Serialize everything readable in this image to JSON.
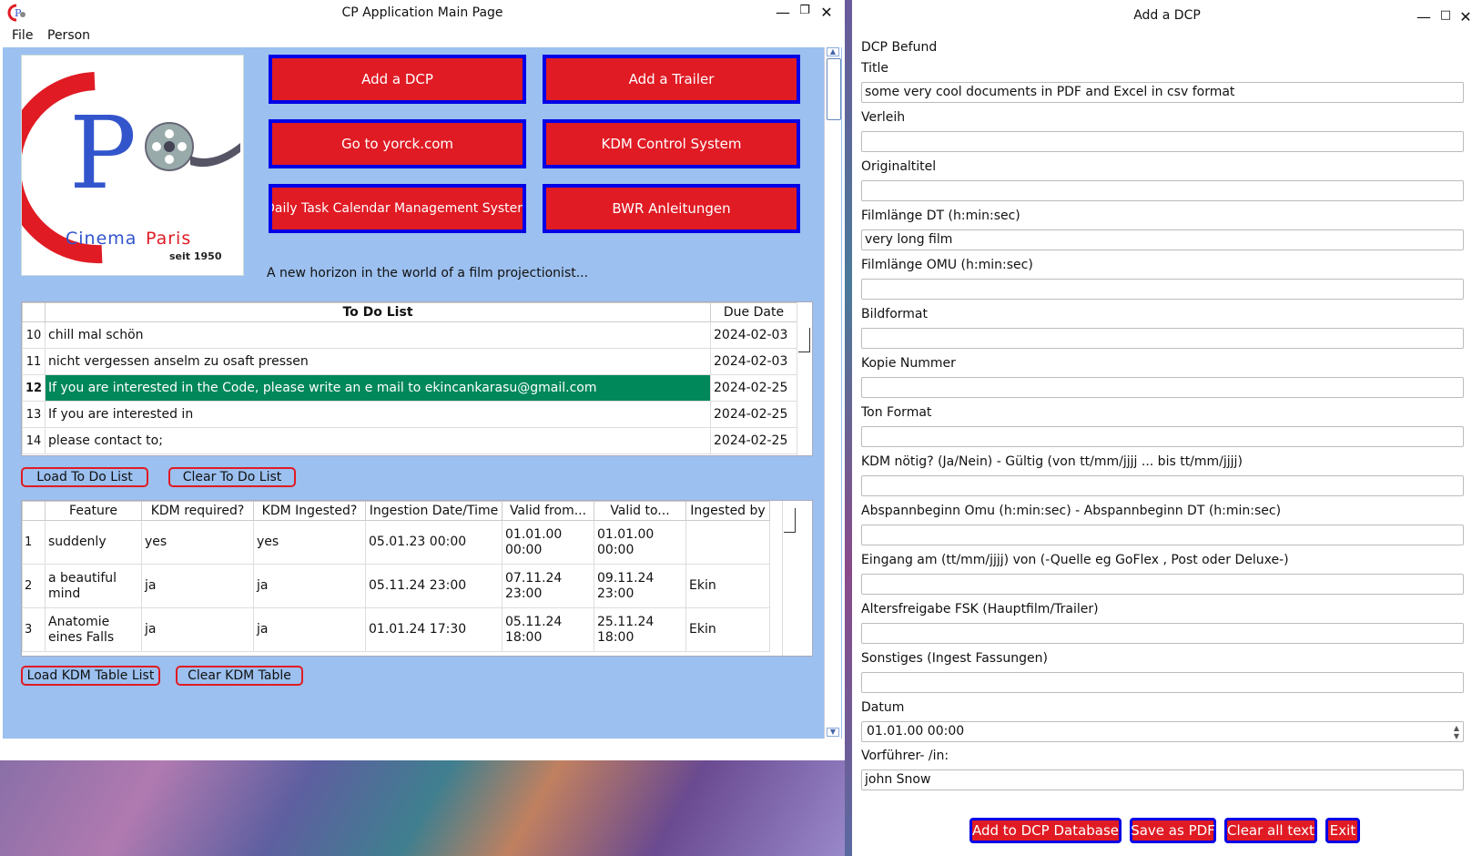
{
  "main_window": {
    "title": "CP Application Main Page",
    "menu": [
      "File",
      "Person"
    ],
    "logo": {
      "letter": "P",
      "name_1": "Cinema",
      "name_2": "Paris",
      "since": "seit 1950"
    },
    "buttons": [
      "Add a DCP",
      "Add a Trailer",
      "Go to yorck.com",
      "KDM Control System",
      "Daily Task Calendar Management System",
      "BWR Anleitungen"
    ],
    "tagline": "A new horizon in the world of a film projectionist...",
    "todo": {
      "headers": [
        "To Do List",
        "Due Date"
      ],
      "rows": [
        {
          "n": "10",
          "task": "chill mal schön",
          "due": "2024-02-03"
        },
        {
          "n": "11",
          "task": "nicht vergessen anselm zu osaft pressen",
          "due": "2024-02-03"
        },
        {
          "n": "12",
          "task": "If you are interested in the Code, please write an e mail to ekincankarasu@gmail.com",
          "due": "2024-02-25"
        },
        {
          "n": "13",
          "task": "If you are interested in",
          "due": "2024-02-25"
        },
        {
          "n": "14",
          "task": "please contact to;",
          "due": "2024-02-25"
        }
      ],
      "selected_row": "12",
      "load_label": "Load To Do List",
      "clear_label": "Clear To Do List"
    },
    "kdm": {
      "headers": [
        "Feature",
        "KDM required?",
        "KDM Ingested?",
        "Ingestion Date/Time",
        "Valid from...",
        "Valid to...",
        "Ingested by"
      ],
      "rows": [
        {
          "n": "1",
          "feature": "suddenly",
          "required": "yes",
          "ingested": "yes",
          "date": "05.01.23 00:00",
          "from": "01.01.00 00:00",
          "to": "01.01.00 00:00",
          "by": ""
        },
        {
          "n": "2",
          "feature": "a beautiful mind",
          "required": "ja",
          "ingested": "ja",
          "date": "05.11.24 23:00",
          "from": "07.11.24 23:00",
          "to": "09.11.24 23:00",
          "by": "Ekin"
        },
        {
          "n": "3",
          "feature": "Anatomie eines Falls",
          "required": "ja",
          "ingested": "ja",
          "date": "01.01.24 17:30",
          "from": "05.11.24 18:00",
          "to": "25.11.24 18:00",
          "by": "Ekin"
        }
      ],
      "load_label": "Load KDM Table List",
      "clear_label": "Clear KDM Table"
    }
  },
  "dcp_window": {
    "title": "Add a DCP",
    "heading": "DCP Befund",
    "fields": [
      {
        "label": "Title",
        "value": "some very cool documents in PDF and Excel in csv format"
      },
      {
        "label": "Verleih",
        "value": ""
      },
      {
        "label": "Originaltitel",
        "value": ""
      },
      {
        "label": "Filmlänge DT (h:min:sec)",
        "value": "very long film"
      },
      {
        "label": "Filmlänge OMU (h:min:sec)",
        "value": ""
      },
      {
        "label": "Bildformat",
        "value": ""
      },
      {
        "label": "Kopie Nummer",
        "value": ""
      },
      {
        "label": "Ton Format",
        "value": ""
      },
      {
        "label": "KDM nötig? (Ja/Nein)  -  Gültig (von tt/mm/jjjj ... bis tt/mm/jjjj)",
        "value": ""
      },
      {
        "label": "Abspannbeginn Omu (h:min:sec) - Abspannbeginn DT (h:min:sec)",
        "value": ""
      },
      {
        "label": "Eingang am (tt/mm/jjjj) von (-Quelle eg GoFlex , Post oder Deluxe-)",
        "value": ""
      },
      {
        "label": "Altersfreigabe FSK  (Hauptfilm/Trailer)",
        "value": ""
      },
      {
        "label": "Sonstiges (Ingest Fassungen)",
        "value": ""
      },
      {
        "label": "Datum",
        "value": "01.01.00 00:00"
      },
      {
        "label": "Vorführer- /in:",
        "value": "john Snow"
      }
    ],
    "buttons": [
      "Add to DCP Database",
      "Save as PDF",
      "Clear all text",
      "Exit"
    ]
  },
  "colors": {
    "button_red": "#e01b24",
    "button_border_blue": "#0000e6",
    "panel_blue": "#9cc0ef",
    "selection_green": "#00875a"
  },
  "icons": [
    "app-icon",
    "minimize-icon",
    "maximize-icon",
    "close-icon"
  ]
}
